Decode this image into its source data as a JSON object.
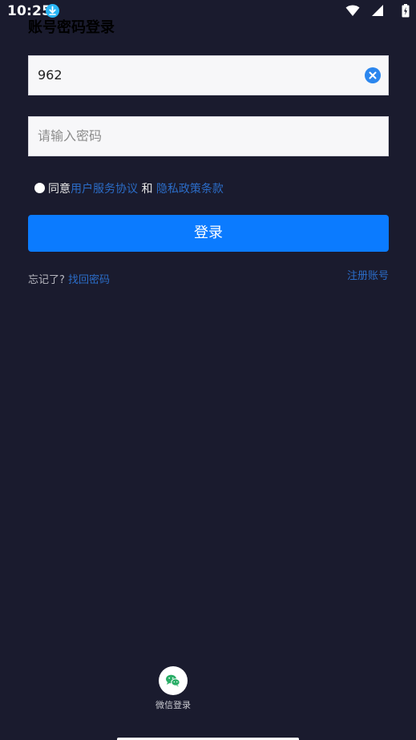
{
  "status_bar": {
    "time": "10:25",
    "icons": [
      "download-icon",
      "wifi-icon",
      "cellular-icon",
      "battery-icon"
    ]
  },
  "header": {
    "title": "账号密码登录"
  },
  "form": {
    "account_value": "962",
    "password_placeholder": "请输入密码"
  },
  "agreement": {
    "prefix": "同意",
    "user_agreement": "用户服务协议",
    "connector": "和",
    "privacy_policy": "隐私政策条款"
  },
  "actions": {
    "login_label": "登录",
    "forgot_label": "忘记了?",
    "recover_link": "找回密码",
    "register_link": "注册账号"
  },
  "social": {
    "wechat_label": "微信登录"
  },
  "colors": {
    "background": "#1a1b2e",
    "primary": "#0b7bff",
    "link": "#2b6cc7",
    "wechat": "#2aae67"
  }
}
